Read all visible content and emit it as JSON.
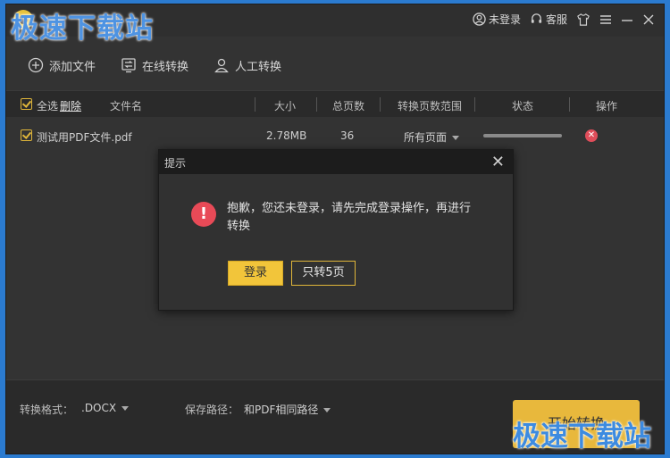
{
  "watermark": "极速下载站",
  "titlebar": {
    "app_name": "",
    "login_label": "未登录",
    "service_label": "客服"
  },
  "toolbar": {
    "add_file": "添加文件",
    "online_convert": "在线转换",
    "manual_convert": "人工转换"
  },
  "table": {
    "select_all": "全选",
    "delete": "删除",
    "columns": [
      "文件名",
      "大小",
      "总页数",
      "转换页数范围",
      "状态",
      "操作"
    ],
    "rows": [
      {
        "name": "测试用PDF文件.pdf",
        "size": "2.78MB",
        "pages": "36",
        "range": "所有页面",
        "progress": 0
      }
    ]
  },
  "dialog": {
    "title": "提示",
    "message": "抱歉，您还未登录，请先完成登录操作，再进行转换",
    "login_button": "登录",
    "five_pages_button": "只转5页"
  },
  "footer": {
    "format_label": "转换格式：",
    "format_value": ".DOCX",
    "path_label": "保存路径：",
    "path_value": "和PDF相同路径",
    "start_button": "开始转换"
  },
  "colors": {
    "accent": "#f2c53a",
    "error": "#e84a57",
    "background": "#333333"
  }
}
